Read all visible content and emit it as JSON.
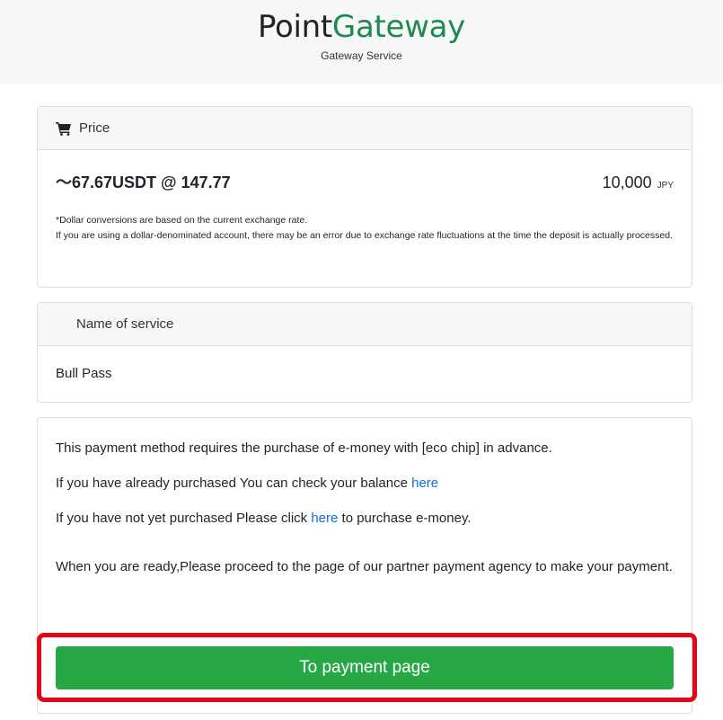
{
  "header": {
    "brand_point": "Point",
    "brand_gateway": "Gateway",
    "tagline": "Gateway Service"
  },
  "price": {
    "header_label": "Price",
    "usdt_text": "～67.67USDT @ 147.77",
    "jpy_amount": "10,000",
    "jpy_unit": "JPY",
    "note_line1": "*Dollar conversions are based on the current exchange rate.",
    "note_line2": "If you are using a dollar-denominated account, there may be an error due to exchange rate fluctuations at the time the deposit is actually processed."
  },
  "service": {
    "header_label": "Name of service",
    "name": "Bull Pass"
  },
  "info": {
    "line1": "This payment method requires the purchase of e-money with [eco chip] in advance.",
    "line2_prefix": "If you have already purchased You can check your balance ",
    "line2_link": "here",
    "line3_prefix": "If you have not yet purchased Please click ",
    "line3_link": "here",
    "line3_suffix": " to purchase e-money.",
    "ready": "When you are ready,Please proceed to the page of our partner payment agency to make your payment."
  },
  "actions": {
    "pay_label": "To payment page"
  },
  "colors": {
    "brand_green": "#1e8a52",
    "button_green": "#28a745",
    "link_blue": "#0b6fd6",
    "highlight_red": "#e30613"
  },
  "icons": {
    "price_header": "cart-icon"
  }
}
